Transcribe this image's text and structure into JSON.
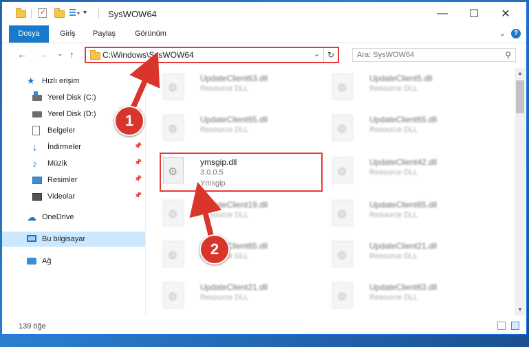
{
  "window": {
    "title": "SysWOW64",
    "minimize_glyph": "—",
    "maximize_glyph": "☐",
    "close_glyph": "✕"
  },
  "ribbon": {
    "tabs": [
      "Dosya",
      "Giriş",
      "Paylaş",
      "Görünüm"
    ],
    "expand_glyph": "⌄",
    "help_glyph": "?"
  },
  "nav": {
    "back_glyph": "←",
    "forward_glyph": "→",
    "recent_glyph": "⌄",
    "up_glyph": "↑",
    "address": "C:\\Windows\\SysWOW64",
    "address_dropdown_glyph": "⌄",
    "refresh_glyph": "↻",
    "search_placeholder": "Ara: SysWOW64",
    "search_glyph": "⚲"
  },
  "sidebar": {
    "items": [
      {
        "label": "Hızlı erişim",
        "icon": "star-icon",
        "glyph": "★"
      },
      {
        "label": "Yerel Disk (C:)",
        "icon": "drive-c-icon",
        "pinned": true
      },
      {
        "label": "Yerel Disk (D:)",
        "icon": "drive-d-icon",
        "pinned": true
      },
      {
        "label": "Belgeler",
        "icon": "documents-icon",
        "pinned": true
      },
      {
        "label": "İndirmeler",
        "icon": "download-icon",
        "glyph": "↓",
        "pinned": true
      },
      {
        "label": "Müzik",
        "icon": "music-icon",
        "glyph": "♪",
        "pinned": true
      },
      {
        "label": "Resimler",
        "icon": "pictures-icon",
        "pinned": true
      },
      {
        "label": "Videolar",
        "icon": "videos-icon",
        "pinned": true
      },
      {
        "label": "OneDrive",
        "icon": "cloud-icon",
        "glyph": "☁"
      },
      {
        "label": "Bu bilgisayar",
        "icon": "computer-icon",
        "selected": true
      },
      {
        "label": "Ağ",
        "icon": "network-icon"
      }
    ],
    "pin_glyph": "📌"
  },
  "files": {
    "left_column": [
      {
        "name": "UpdateClient63.dll",
        "type": "Resource DLL"
      },
      {
        "name": "UpdateClient65.dll",
        "type": "Resource DLL"
      },
      {
        "name": "ymsgip.dll",
        "type": "3.0.0.5",
        "extra": "Ymsgip",
        "highlighted": true
      },
      {
        "name": "UpdateClient19.dll",
        "type": "Resource DLL"
      },
      {
        "name": "UpdateClient65.dll",
        "type": "Resource DLL"
      },
      {
        "name": "UpdateClient21.dll",
        "type": "Resource DLL"
      }
    ],
    "right_column": [
      {
        "name": "UpdateClient5.dll",
        "type": "Resource DLL"
      },
      {
        "name": "UpdateClient65.dll",
        "type": "Resource DLL"
      },
      {
        "name": "UpdateClient42.dll",
        "type": "Resource DLL"
      },
      {
        "name": "UpdateClient65.dll",
        "type": "Resource DLL"
      },
      {
        "name": "UpdateClient21.dll",
        "type": "Resource DLL"
      },
      {
        "name": "UpdateClient63.dll",
        "type": "Resource DLL"
      }
    ]
  },
  "scroll": {
    "up_glyph": "▲",
    "down_glyph": "▼"
  },
  "status": {
    "item_count": "139 öğe"
  },
  "annotations": {
    "step1": "1",
    "step2": "2",
    "accent_color": "#d9352b"
  }
}
